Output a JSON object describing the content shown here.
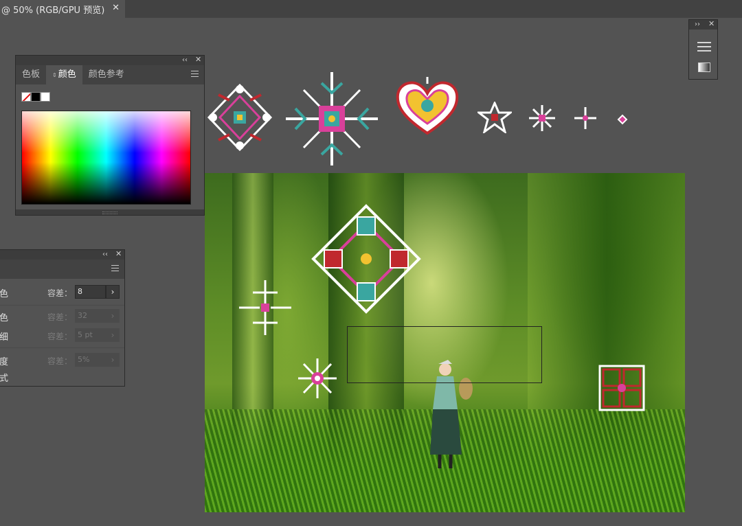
{
  "document_tab": {
    "title": "@ 50% (RGB/GPU 预览)",
    "close_glyph": "✕"
  },
  "color_panel": {
    "collapse_glyph": "‹‹",
    "close_glyph": "✕",
    "tabs": [
      {
        "label": "色板",
        "active": false
      },
      {
        "label": "颜色",
        "active": true
      },
      {
        "label": "颜色参考",
        "active": false
      }
    ],
    "active_tab_arrows": "⇕",
    "swatches": [
      "none-icon",
      "black",
      "white"
    ]
  },
  "wand_panel": {
    "collapse_glyph": "‹‹",
    "close_glyph": "✕",
    "rows": [
      {
        "label": "色",
        "tol_label": "容差：",
        "value": "8",
        "enabled": true
      },
      {
        "label": "色",
        "tol_label": "容差：",
        "value": "32",
        "enabled": false
      },
      {
        "label": "细",
        "tol_label": "容差：",
        "value": "5 pt",
        "enabled": false
      },
      {
        "label": "度",
        "tol_label": "容差：",
        "value": "5%",
        "enabled": false
      }
    ],
    "extra_label": "式",
    "step_glyph": "›"
  },
  "mini_dock": {
    "collapse_glyph": "››",
    "close_glyph": "✕",
    "icons": [
      "properties-icon",
      "gradient-icon"
    ]
  },
  "colors": {
    "motif_white": "#ffffff",
    "motif_pink": "#d9409a",
    "motif_teal": "#3aa6a0",
    "motif_red": "#c0282e",
    "motif_yellow": "#f2c230"
  }
}
